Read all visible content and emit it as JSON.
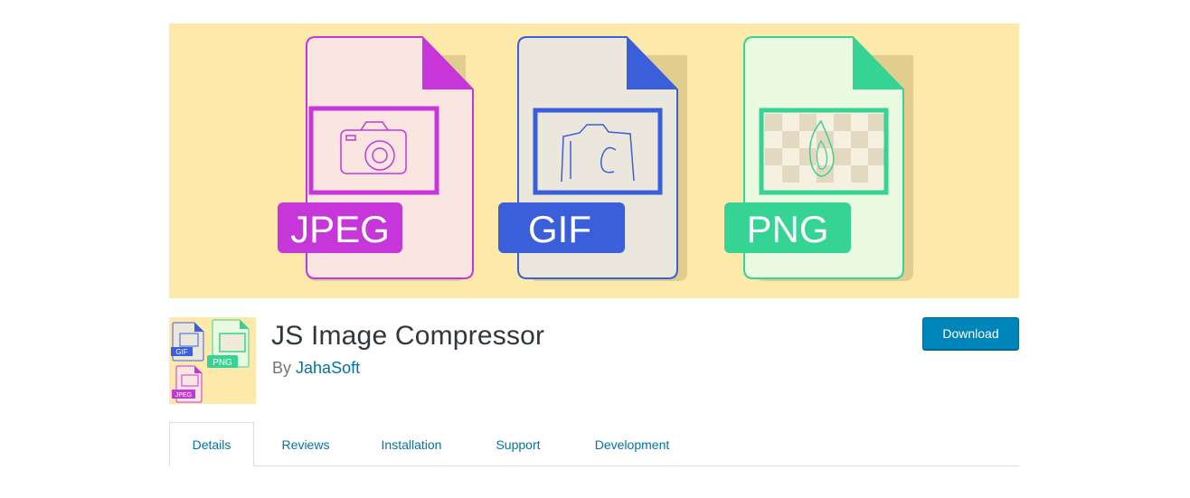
{
  "banner": {
    "background": "#fde9a9",
    "files": [
      {
        "label": "JPEG",
        "color": "#c736d9",
        "paper": "#f9e6e1",
        "icon": "camera-icon"
      },
      {
        "label": "GIF",
        "color": "#3b5fdb",
        "paper": "#ebe7dd",
        "icon": "camera-sketch-icon"
      },
      {
        "label": "PNG",
        "color": "#35d394",
        "paper": "#eafae1",
        "icon": "flame-icon"
      }
    ]
  },
  "plugin": {
    "title": "JS Image Compressor",
    "by_prefix": "By",
    "author": "JahaSoft",
    "icon_labels": {
      "gif": "GIF",
      "png": "PNG",
      "jpeg": "JPEG"
    }
  },
  "actions": {
    "download_label": "Download"
  },
  "tabs": [
    {
      "label": "Details",
      "active": true
    },
    {
      "label": "Reviews",
      "active": false
    },
    {
      "label": "Installation",
      "active": false
    },
    {
      "label": "Support",
      "active": false
    },
    {
      "label": "Development",
      "active": false
    }
  ],
  "colors": {
    "link": "#0073aa",
    "button": "#0085ba"
  }
}
